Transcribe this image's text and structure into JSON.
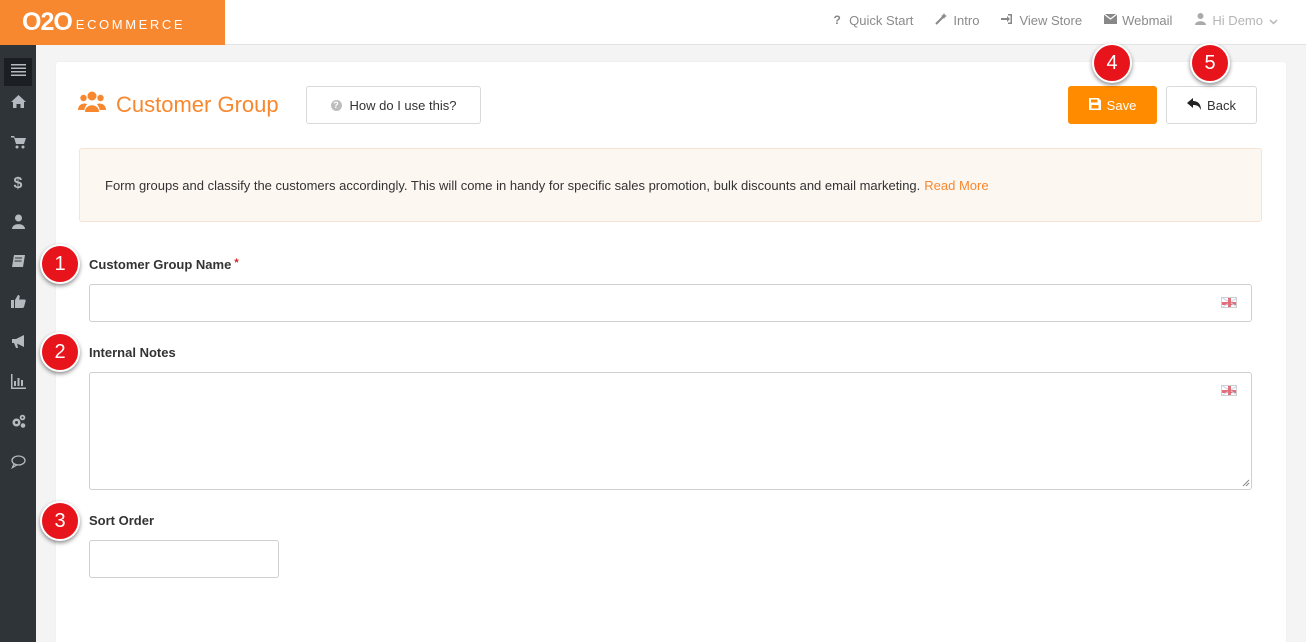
{
  "brand": {
    "main": "O2O",
    "sub": "ECOMMERCE",
    "color": "#f7882f"
  },
  "topnav": [
    {
      "label": "Quick Start",
      "icon": "question-icon"
    },
    {
      "label": "Intro",
      "icon": "wand-icon"
    },
    {
      "label": "View Store",
      "icon": "sign-in-icon"
    },
    {
      "label": "Webmail",
      "icon": "envelope-icon"
    },
    {
      "label": "Hi Demo",
      "icon": "user-icon"
    }
  ],
  "sidebar": [
    {
      "name": "menu-toggle",
      "icon": "bars-icon"
    },
    {
      "name": "home",
      "icon": "home-icon"
    },
    {
      "name": "orders",
      "icon": "cart-icon"
    },
    {
      "name": "sales",
      "icon": "dollar-icon"
    },
    {
      "name": "customers",
      "icon": "user-icon"
    },
    {
      "name": "catalog",
      "icon": "book-icon"
    },
    {
      "name": "reviews",
      "icon": "thumbs-up-icon"
    },
    {
      "name": "marketing",
      "icon": "bullhorn-icon"
    },
    {
      "name": "reports",
      "icon": "bar-chart-icon"
    },
    {
      "name": "settings",
      "icon": "gears-icon"
    },
    {
      "name": "chat",
      "icon": "comment-icon"
    }
  ],
  "page": {
    "title": "Customer Group",
    "help_label": "How do I use this?",
    "save_label": "Save",
    "back_label": "Back",
    "info_text": "Form groups and classify the customers accordingly. This will come in handy for specific sales promotion, bulk discounts and email marketing.",
    "read_more": "Read More"
  },
  "form": {
    "group_name": {
      "label": "Customer Group Name",
      "required": "*",
      "value": ""
    },
    "internal_notes": {
      "label": "Internal Notes",
      "value": ""
    },
    "sort_order": {
      "label": "Sort Order",
      "value": ""
    }
  },
  "badges": [
    "1",
    "2",
    "3",
    "4",
    "5"
  ],
  "colors": {
    "accent": "#f7882f",
    "save": "#ff8c00",
    "badge": "#e8141b",
    "sidebar": "#2f3439"
  }
}
